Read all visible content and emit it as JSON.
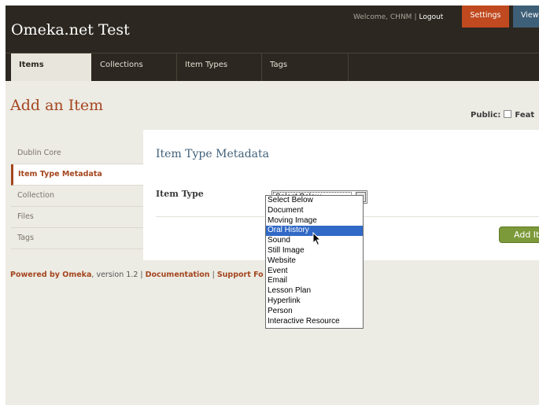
{
  "header": {
    "site_title": "Omeka.net Test",
    "welcome": "Welcome, CHNM",
    "separator": "|",
    "logout": "Logout",
    "settings": "Settings",
    "view": "View"
  },
  "nav": {
    "tabs": [
      {
        "label": "Items"
      },
      {
        "label": "Collections"
      },
      {
        "label": "Item Types"
      },
      {
        "label": "Tags"
      }
    ]
  },
  "page": {
    "heading": "Add an Item",
    "public_label": "Public:",
    "featured_label": "Feat"
  },
  "sidebar": {
    "items": [
      {
        "label": "Dublin Core"
      },
      {
        "label": "Item Type Metadata"
      },
      {
        "label": "Collection"
      },
      {
        "label": "Files"
      },
      {
        "label": "Tags"
      }
    ]
  },
  "main": {
    "section_title": "Item Type Metadata",
    "item_type_label": "Item Type",
    "select_value": "Select Below",
    "add_button": "Add It"
  },
  "dropdown": {
    "options": [
      "Select Below",
      "Document",
      "Moving Image",
      "Oral History",
      "Sound",
      "Still Image",
      "Website",
      "Event",
      "Email",
      "Lesson Plan",
      "Hyperlink",
      "Person",
      "Interactive Resource"
    ],
    "highlighted": "Oral History"
  },
  "footer": {
    "powered": "Powered by Omeka",
    "version": ", version 1.2 | ",
    "documentation": "Documentation",
    "sep": " | ",
    "support": "Support Fo"
  },
  "colors": {
    "header_bg": "#2c2720",
    "accent": "#a4461f",
    "settings_btn": "#c0491f",
    "view_btn": "#3e5f78",
    "add_btn": "#7d9a3a",
    "highlight": "#3169c6"
  },
  "icons": {
    "cursor": "mouse-pointer-icon",
    "select_arrow": "chevron-down-icon"
  }
}
